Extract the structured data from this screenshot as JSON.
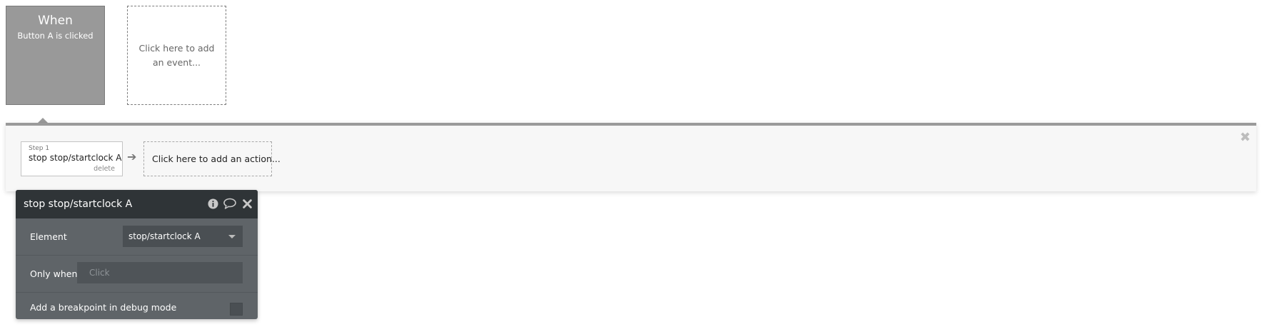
{
  "event": {
    "when_label": "When",
    "trigger_text": "Button A is clicked"
  },
  "add_event": {
    "label": "Click here to add an event..."
  },
  "actions": {
    "steps": [
      {
        "step_label": "Step 1",
        "name": "stop stop/startclock A",
        "delete_label": "delete"
      }
    ],
    "add_action_label": "Click here to add an action..."
  },
  "properties": {
    "title": "stop stop/startclock A",
    "element_label": "Element",
    "element_value": "stop/startclock A",
    "only_when_label": "Only when",
    "only_when_placeholder": "Click",
    "breakpoint_label": "Add a breakpoint in debug mode"
  },
  "icons": {
    "info": "info-icon",
    "comment": "comment-icon",
    "close": "close-icon",
    "arrow": "arrow-right-icon"
  },
  "colors": {
    "event_card": "#999999",
    "panel_bg": "#5f6468",
    "panel_header": "#2f3437"
  }
}
